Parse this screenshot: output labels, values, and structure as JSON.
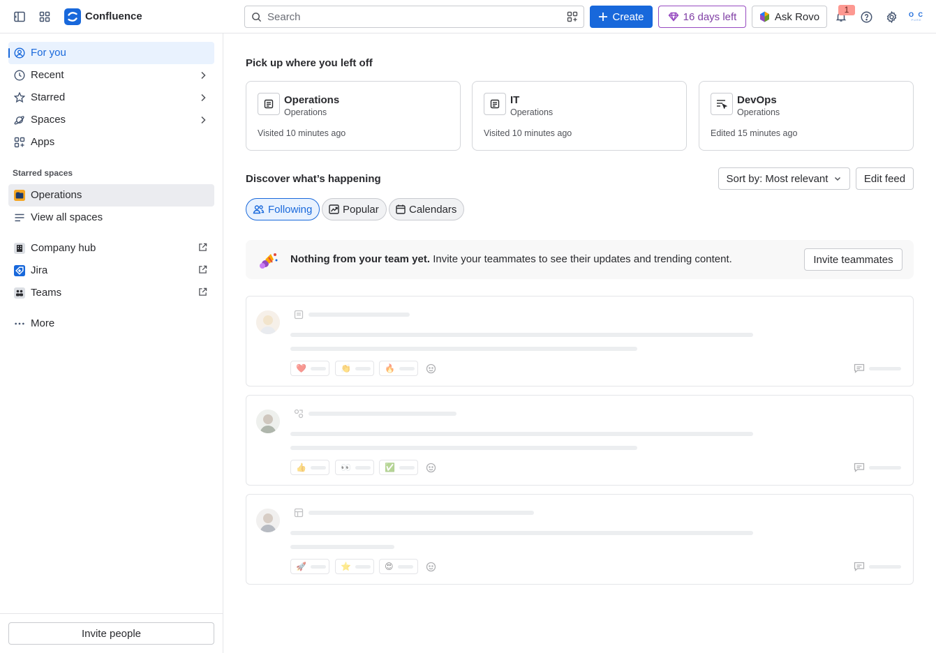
{
  "app": {
    "name": "Confluence"
  },
  "search": {
    "placeholder": "Search"
  },
  "topbar": {
    "create_label": "Create",
    "trial_label": "16 days left",
    "rovo_label": "Ask Rovo",
    "notification_count": "1",
    "avatar_initials": "O C",
    "avatar_sub": "PURE",
    "colors": {
      "brand": "#1868db",
      "trial": "#803fa5",
      "badge": "#fd9891"
    }
  },
  "sidebar": {
    "items": [
      {
        "label": "For you",
        "icon": "user-circle-icon"
      },
      {
        "label": "Recent",
        "icon": "clock-icon"
      },
      {
        "label": "Starred",
        "icon": "star-icon"
      },
      {
        "label": "Spaces",
        "icon": "planet-icon"
      },
      {
        "label": "Apps",
        "icon": "apps-add-icon"
      }
    ],
    "starred_spaces_label": "Starred spaces",
    "starred_spaces": [
      {
        "label": "Operations",
        "icon": "operations-space-icon"
      }
    ],
    "view_all_spaces": "View all spaces",
    "external": [
      {
        "label": "Company hub",
        "icon": "building-icon"
      },
      {
        "label": "Jira",
        "icon": "jira-icon"
      },
      {
        "label": "Teams",
        "icon": "teams-icon"
      }
    ],
    "more_label": "More",
    "invite_label": "Invite people"
  },
  "main": {
    "recent_heading": "Pick up where you left off",
    "recent_cards": [
      {
        "title": "Operations",
        "space": "Operations",
        "status": "Visited 10 minutes ago",
        "icon": "page-icon"
      },
      {
        "title": "IT",
        "space": "Operations",
        "status": "Visited 10 minutes ago",
        "icon": "page-icon"
      },
      {
        "title": "DevOps",
        "space": "Operations",
        "status": "Edited 15 minutes ago",
        "icon": "live-doc-icon"
      }
    ],
    "discover_heading": "Discover what’s happening",
    "sort_label": "Sort by: Most relevant",
    "edit_feed_label": "Edit feed",
    "tabs": [
      {
        "label": "Following",
        "icon": "people-icon",
        "active": true
      },
      {
        "label": "Popular",
        "icon": "trend-icon",
        "active": false
      },
      {
        "label": "Calendars",
        "icon": "calendar-icon",
        "active": false
      }
    ],
    "banner": {
      "bold": "Nothing from your team yet.",
      "text": " Invite your teammates to see their updates and trending content.",
      "button": "Invite teammates"
    },
    "feed_placeholders": [
      {
        "reactions": [
          "❤️",
          "👏",
          "🔥"
        ],
        "type_icon": "page-icon"
      },
      {
        "reactions": [
          "👍",
          "👀",
          "✅"
        ],
        "type_icon": "whiteboard-icon"
      },
      {
        "reactions": [
          "🚀",
          "⭐",
          "😍"
        ],
        "type_icon": "database-icon"
      }
    ]
  }
}
